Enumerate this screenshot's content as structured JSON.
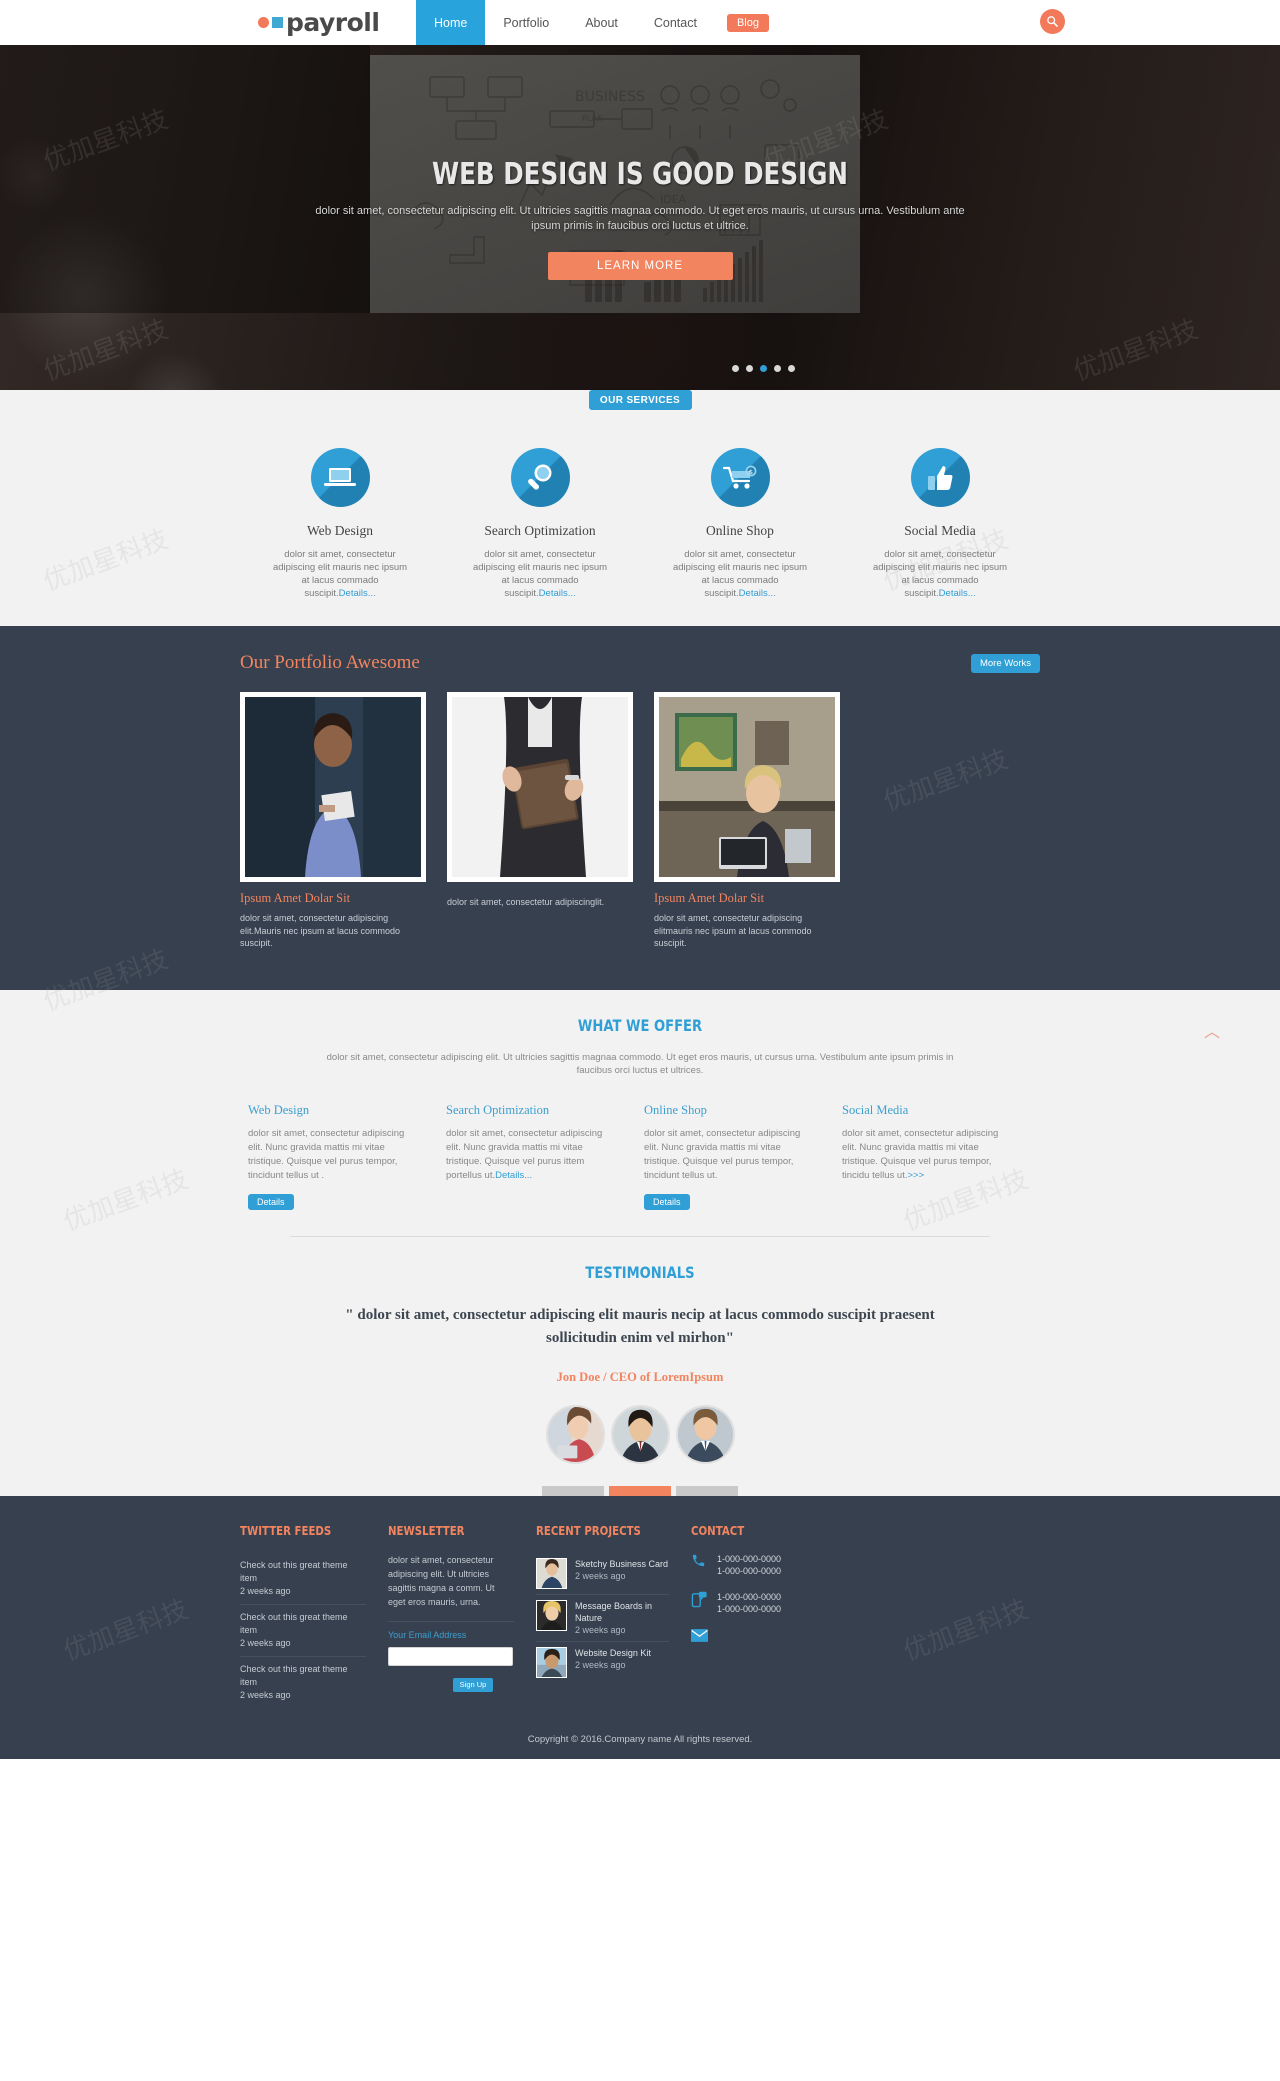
{
  "header": {
    "logo_text": "payroll",
    "nav": [
      {
        "label": "Home",
        "active": true
      },
      {
        "label": "Portfolio",
        "active": false
      },
      {
        "label": "About",
        "active": false
      },
      {
        "label": "Contact",
        "active": false
      }
    ],
    "blog_label": "Blog",
    "search_icon": "search-icon"
  },
  "hero": {
    "title": "WEB DESIGN IS GOOD DESIGN",
    "subtitle": "dolor sit amet, consectetur adipiscing elit. Ut ultricies sagittis magnaa commodo. Ut eget eros mauris, ut cursus urna. Vestibulum ante ipsum primis in faucibus orci luctus et ultrice.",
    "cta_label": "LEARN MORE",
    "slide_count": 5,
    "active_slide": 3
  },
  "services": {
    "tag_label": "OUR SERVICES",
    "items": [
      {
        "icon": "laptop-icon",
        "title": "Web Design",
        "desc": "dolor sit amet, consectetur adipiscing elit mauris nec ipsum at lacus commado suscipit.",
        "link": "Details..."
      },
      {
        "icon": "magnifier-icon",
        "title": "Search Optimization",
        "desc": "dolor sit amet, consectetur adipiscing elit mauris nec ipsum at lacus commado suscipit.",
        "link": "Details..."
      },
      {
        "icon": "shopping-cart-icon",
        "title": "Online Shop",
        "desc": "dolor sit amet, consectetur adipiscing elit mauris nec ipsum at lacus commado suscipit.",
        "link": "Details..."
      },
      {
        "icon": "thumbs-up-icon",
        "title": "Social Media",
        "desc": "dolor sit amet, consectetur adipiscing elit mauris nec ipsum at lacus commado suscipit.",
        "link": "Details..."
      }
    ]
  },
  "portfolio": {
    "title": "Our Portfolio Awesome",
    "more_label": "More Works",
    "items": [
      {
        "caption": "Ipsum Amet Dolar Sit",
        "text": "dolor sit amet, consectetur adipiscing elit.Mauris nec ipsum at lacus commodo suscipit."
      },
      {
        "caption": "",
        "text": "dolor sit amet, consectetur adipiscinglit."
      },
      {
        "caption": "Ipsum Amet Dolar Sit",
        "text": "dolor sit amet, consectetur adipiscing elitmauris nec ipsum at lacus commodo suscipit."
      }
    ]
  },
  "offer": {
    "title": "WHAT WE OFFER",
    "subtitle": "dolor sit amet, consectetur adipiscing elit. Ut ultricies sagittis magnaa commodo. Ut eget eros mauris, ut cursus urna. Vestibulum ante ipsum primis in faucibus orci luctus et ultrices.",
    "columns": [
      {
        "heading": "Web Design",
        "body": "dolor sit amet, consectetur adipiscing elit. Nunc gravida mattis mi vitae tristique. Quisque vel purus tempor, tincidunt tellus ut .",
        "link": "",
        "button": "Details"
      },
      {
        "heading": "Search Optimization",
        "body": "dolor sit amet, consectetur adipiscing elit. Nunc gravida mattis mi vitae tristique. Quisque vel purus ittem portellus ut.",
        "link": "Details...",
        "button": ""
      },
      {
        "heading": "Online Shop",
        "body": "dolor sit amet, consectetur adipiscing elit. Nunc gravida mattis mi vitae tristique. Quisque vel purus tempor, tincidunt tellus ut.",
        "link": "",
        "button": "Details"
      },
      {
        "heading": "Social Media",
        "body": "dolor sit amet, consectetur adipiscing elit. Nunc gravida mattis mi vitae tristique. Quisque vel purus tempor, tincidu tellus ut.",
        "link": ">>>",
        "button": ""
      }
    ]
  },
  "testimonials": {
    "title": "TESTIMONIALS",
    "quote": "\" dolor sit amet, consectetur adipiscing elit mauris necip at lacus commodo suscipit praesent sollicitudin enim vel mirhon\"",
    "author": "Jon Doe / CEO of LoremIpsum",
    "avatar_count": 3,
    "bar_count": 3,
    "active_bar": 1
  },
  "footer": {
    "twitter": {
      "heading": "TWITTER FEEDS",
      "items": [
        {
          "text": "Check out this great theme item",
          "time": "2 weeks ago"
        },
        {
          "text": "Check out this great theme item",
          "time": "2 weeks ago"
        },
        {
          "text": "Check out this great theme item",
          "time": "2 weeks ago"
        }
      ]
    },
    "newsletter": {
      "heading": "NEWSLETTER",
      "body": "dolor sit amet, consectetur adipiscing elit. Ut ultricies sagittis magna a comm. Ut eget eros mauris, urna.",
      "label": "Your Email Address",
      "input_value": "",
      "input_placeholder": "",
      "button": "Sign Up"
    },
    "projects": {
      "heading": "RECENT PROJECTS",
      "items": [
        {
          "title": "Sketchy Business Card",
          "time": "2 weeks ago"
        },
        {
          "title": "Message Boards in Nature",
          "time": "2 weeks ago"
        },
        {
          "title": "Website Design Kit",
          "time": "2 weeks ago"
        }
      ]
    },
    "contact": {
      "heading": "CONTACT",
      "items": [
        {
          "icon": "phone-icon",
          "lines": [
            "1-000-000-0000",
            "1-000-000-0000"
          ]
        },
        {
          "icon": "mobile-chat-icon",
          "lines": [
            "1-000-000-0000",
            "1-000-000-0000"
          ]
        },
        {
          "icon": "envelope-icon",
          "lines": []
        }
      ]
    },
    "copyright": "Copyright © 2016.Company name All rights reserved."
  },
  "colors": {
    "brand_blue": "#2f9fd6",
    "brand_orange": "#f2845f",
    "dark_navy": "#36404e",
    "light_gray": "#f2f2f2"
  },
  "watermarks": [
    "优加星科技",
    "优加星科技",
    "优加星科技",
    "优加星科技",
    "优加星科技",
    "优加星科技",
    "优加星科技",
    "优加星科技",
    "优加星科技",
    "优加星科技",
    "优加星科技",
    "优加星科技"
  ]
}
